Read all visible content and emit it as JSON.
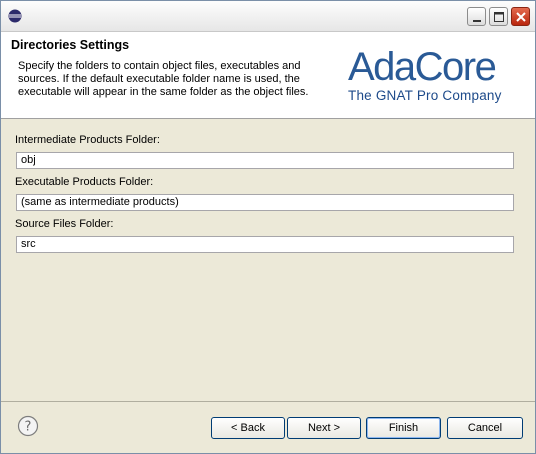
{
  "window": {
    "title": "",
    "icon": "eclipse-icon"
  },
  "header": {
    "title": "Directories Settings",
    "description": "Specify the folders to contain object files, executables and sources. If the default executable folder name is used, the executable will appear in the same folder as the object files.",
    "logo_main": "AdaCore",
    "logo_sub": "The GNAT Pro Company"
  },
  "fields": [
    {
      "label": "Intermediate Products Folder:",
      "value": "obj"
    },
    {
      "label": "Executable Products Folder:",
      "value": "(same as intermediate products)"
    },
    {
      "label": "Source Files Folder:",
      "value": "src"
    }
  ],
  "footer": {
    "help_icon": "help-icon",
    "back_label": "< Back",
    "next_label": "Next >",
    "finish_label": "Finish",
    "cancel_label": "Cancel"
  },
  "colors": {
    "logo_blue": "#2a5a96",
    "close_red": "#c0391c"
  }
}
